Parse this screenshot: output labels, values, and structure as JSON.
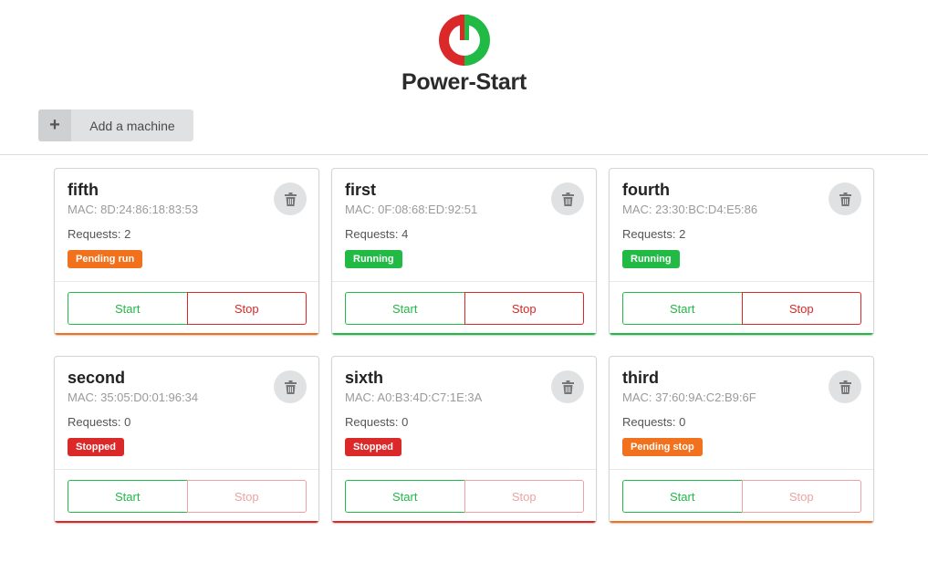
{
  "app": {
    "title": "Power-Start"
  },
  "toolbar": {
    "add_label": "Add a machine",
    "add_icon": "+"
  },
  "labels": {
    "start": "Start",
    "stop": "Stop"
  },
  "colors": {
    "green": "#21ba45",
    "red": "#db2828",
    "orange": "#f2711c"
  },
  "machines": [
    {
      "name": "fifth",
      "mac": "MAC: 8D:24:86:18:83:53",
      "requests": "Requests: 2",
      "status": "Pending run",
      "status_color": "#f2711c",
      "stop_enabled": true
    },
    {
      "name": "first",
      "mac": "MAC: 0F:08:68:ED:92:51",
      "requests": "Requests: 4",
      "status": "Running",
      "status_color": "#21ba45",
      "stop_enabled": true
    },
    {
      "name": "fourth",
      "mac": "MAC: 23:30:BC:D4:E5:86",
      "requests": "Requests: 2",
      "status": "Running",
      "status_color": "#21ba45",
      "stop_enabled": true
    },
    {
      "name": "second",
      "mac": "MAC: 35:05:D0:01:96:34",
      "requests": "Requests: 0",
      "status": "Stopped",
      "status_color": "#db2828",
      "stop_enabled": false
    },
    {
      "name": "sixth",
      "mac": "MAC: A0:B3:4D:C7:1E:3A",
      "requests": "Requests: 0",
      "status": "Stopped",
      "status_color": "#db2828",
      "stop_enabled": false
    },
    {
      "name": "third",
      "mac": "MAC: 37:60:9A:C2:B9:6F",
      "requests": "Requests: 0",
      "status": "Pending stop",
      "status_color": "#f2711c",
      "stop_enabled": false
    }
  ]
}
